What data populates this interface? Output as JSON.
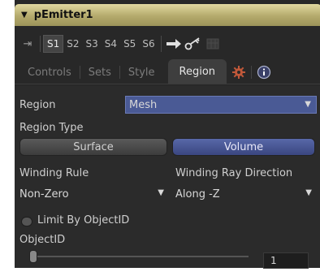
{
  "window": {
    "title": "pEmitter1"
  },
  "toolbar": {
    "slots": [
      "S1",
      "S2",
      "S3",
      "S4",
      "S5",
      "S6"
    ],
    "active_slot": "S1"
  },
  "tabs": {
    "items": [
      "Controls",
      "Sets",
      "Style",
      "Region"
    ],
    "active": "Region"
  },
  "region": {
    "label": "Region",
    "value": "Mesh",
    "type_label": "Region Type",
    "surface_label": "Surface",
    "volume_label": "Volume",
    "winding_rule_label": "Winding Rule",
    "winding_rule_value": "Non-Zero",
    "winding_dir_label": "Winding Ray Direction",
    "winding_dir_value": "Along -Z",
    "limit_label": "Limit By ObjectID",
    "objectid_label": "ObjectID",
    "objectid_value": "1"
  },
  "colors": {
    "title_bar": "#b4aa6c",
    "accent_blue": "#4a5a95",
    "gear": "#c0583a"
  },
  "icons": [
    "pin-icon",
    "arrow-right-icon",
    "key-icon",
    "grid-icon",
    "gear-icon",
    "info-icon",
    "collapse-triangle-icon",
    "dropdown-arrow-icon"
  ]
}
